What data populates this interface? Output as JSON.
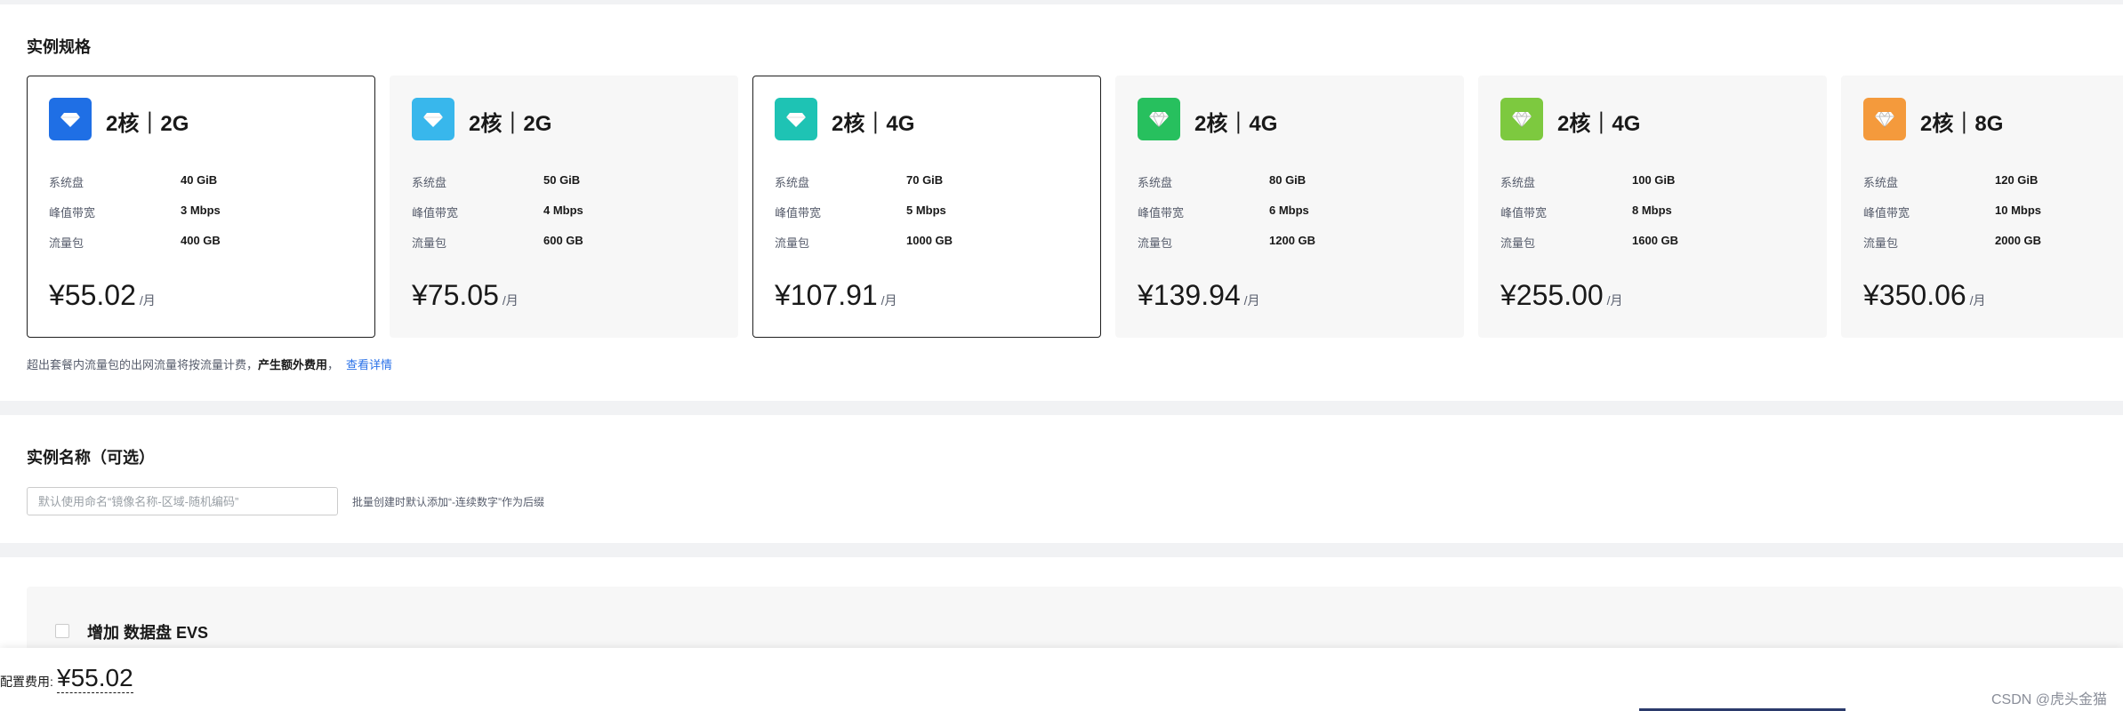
{
  "spec_section": {
    "title": "实例规格",
    "cards": [
      {
        "name": "2核｜2G",
        "icon": "diamond-icon",
        "icon_color": "#1f6fe5",
        "system_disk_label": "系统盘",
        "system_disk": "40 GiB",
        "bandwidth_label": "峰值带宽",
        "bandwidth": "3 Mbps",
        "traffic_label": "流量包",
        "traffic": "400 GB",
        "price": "¥55.02",
        "unit": "/月",
        "selected": true
      },
      {
        "name": "2核｜2G",
        "icon": "diamond-icon",
        "icon_color": "#38b7ec",
        "system_disk_label": "系统盘",
        "system_disk": "50 GiB",
        "bandwidth_label": "峰值带宽",
        "bandwidth": "4 Mbps",
        "traffic_label": "流量包",
        "traffic": "600 GB",
        "price": "¥75.05",
        "unit": "/月",
        "selected": false
      },
      {
        "name": "2核｜4G",
        "icon": "diamond-icon",
        "icon_color": "#1ec3b4",
        "system_disk_label": "系统盘",
        "system_disk": "70 GiB",
        "bandwidth_label": "峰值带宽",
        "bandwidth": "5 Mbps",
        "traffic_label": "流量包",
        "traffic": "1000 GB",
        "price": "¥107.91",
        "unit": "/月",
        "selected": true
      },
      {
        "name": "2核｜4G",
        "icon": "gem-icon",
        "icon_color": "#27c05e",
        "system_disk_label": "系统盘",
        "system_disk": "80 GiB",
        "bandwidth_label": "峰值带宽",
        "bandwidth": "6 Mbps",
        "traffic_label": "流量包",
        "traffic": "1200 GB",
        "price": "¥139.94",
        "unit": "/月",
        "selected": false
      },
      {
        "name": "2核｜4G",
        "icon": "gem-icon",
        "icon_color": "#7dc93f",
        "system_disk_label": "系统盘",
        "system_disk": "100 GiB",
        "bandwidth_label": "峰值带宽",
        "bandwidth": "8 Mbps",
        "traffic_label": "流量包",
        "traffic": "1600 GB",
        "price": "¥255.00",
        "unit": "/月",
        "selected": false
      },
      {
        "name": "2核｜8G",
        "icon": "gem-icon",
        "icon_color": "#f49a3c",
        "system_disk_label": "系统盘",
        "system_disk": "120 GiB",
        "bandwidth_label": "峰值带宽",
        "bandwidth": "10 Mbps",
        "traffic_label": "流量包",
        "traffic": "2000 GB",
        "price": "¥350.06",
        "unit": "/月",
        "selected": false
      }
    ],
    "note_text": "超出套餐内流量包的出网流量将按流量计费，",
    "note_bold": "产生额外费用",
    "note_comma": "，",
    "note_link": "查看详情"
  },
  "name_section": {
    "title": "实例名称（可选）",
    "input_value": "",
    "input_placeholder": "默认使用命名“镜像名称-区域-随机编码”",
    "hint": "批量创建时默认添加“-连续数字”作为后缀"
  },
  "evs_section": {
    "label": "增加 数据盘 EVS",
    "checked": false
  },
  "footer": {
    "fee_label": "配置费用:",
    "fee_value": "¥55.02",
    "watermark": "CSDN @虎头金猫"
  }
}
